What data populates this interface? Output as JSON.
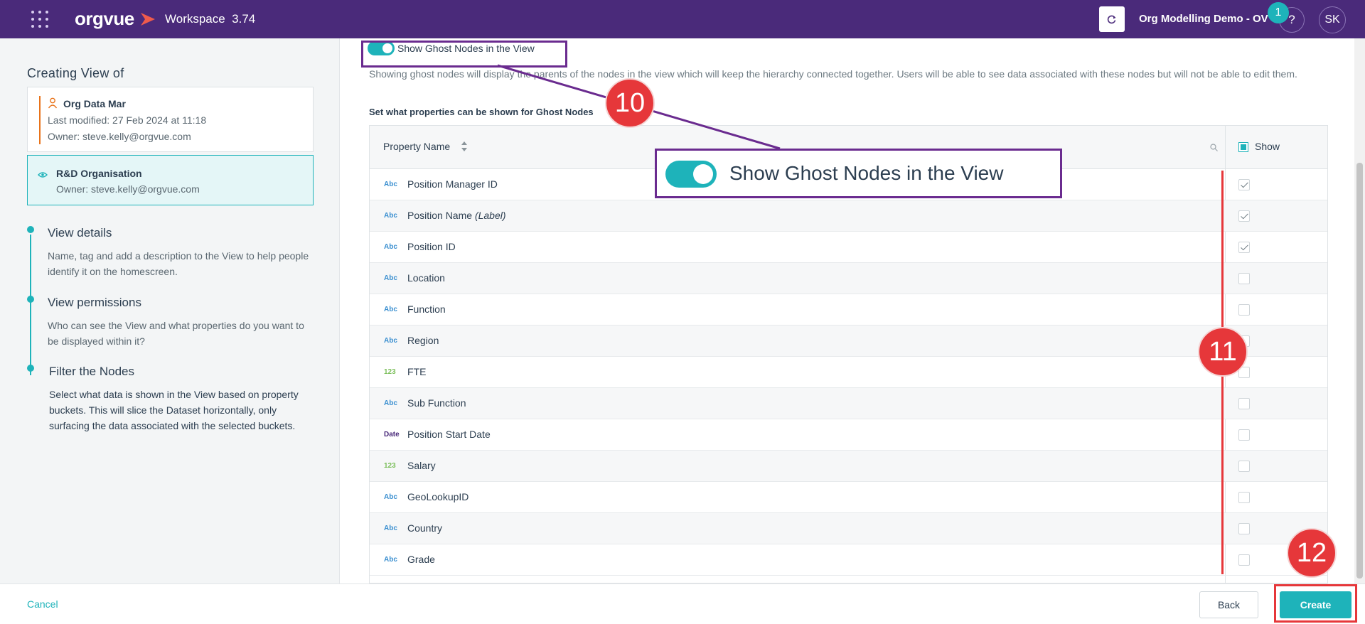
{
  "topbar": {
    "logo_text": "orgvue",
    "workspace_label": "Workspace",
    "version": "3.74",
    "dataset_name": "Org Modelling Demo - OV",
    "notification_count": "1",
    "help_label": "?",
    "user_initials": "SK"
  },
  "left": {
    "creating_title": "Creating View of",
    "dataset": {
      "title": "Org Data Mar",
      "last_modified": "Last modified: 27 Feb 2024 at 11:18",
      "owner": "Owner: steve.kelly@orgvue.com"
    },
    "view": {
      "title": "R&D Organisation",
      "owner": "Owner: steve.kelly@orgvue.com"
    },
    "steps": [
      {
        "title": "View details",
        "desc": "Name, tag and add a description to the View to help people identify it on the homescreen."
      },
      {
        "title": "View permissions",
        "desc": "Who can see the View and what properties do you want to be displayed within it?"
      },
      {
        "title": "Filter the Nodes",
        "desc": "Select what data is shown in the View based on property buckets. This will slice the Dataset horizontally, only surfacing the data associated with the selected buckets."
      }
    ]
  },
  "main": {
    "toggle_label": "Show Ghost Nodes in the View",
    "toggle_on": true,
    "ghost_desc": "Showing ghost nodes will display the parents of the nodes in the view which will keep the hierarchy connected together. Users will be able to see data associated with these nodes but will not be able to edit them.",
    "props_heading": "Set what properties can be shown for Ghost Nodes",
    "table": {
      "col_name": "Property Name",
      "col_show": "Show",
      "rows": [
        {
          "type": "Abc",
          "name": "Position Manager ID",
          "suffix": "",
          "checked": true
        },
        {
          "type": "Abc",
          "name": "Position Name",
          "suffix": "(Label)",
          "checked": true
        },
        {
          "type": "Abc",
          "name": "Position ID",
          "suffix": "",
          "checked": true
        },
        {
          "type": "Abc",
          "name": "Location",
          "suffix": "",
          "checked": false
        },
        {
          "type": "Abc",
          "name": "Function",
          "suffix": "",
          "checked": false
        },
        {
          "type": "Abc",
          "name": "Region",
          "suffix": "",
          "checked": false
        },
        {
          "type": "123",
          "name": "FTE",
          "suffix": "",
          "checked": false
        },
        {
          "type": "Abc",
          "name": "Sub Function",
          "suffix": "",
          "checked": false
        },
        {
          "type": "Date",
          "name": "Position Start Date",
          "suffix": "",
          "checked": false
        },
        {
          "type": "123",
          "name": "Salary",
          "suffix": "",
          "checked": false
        },
        {
          "type": "Abc",
          "name": "GeoLookupID",
          "suffix": "",
          "checked": false
        },
        {
          "type": "Abc",
          "name": "Country",
          "suffix": "",
          "checked": false
        },
        {
          "type": "Abc",
          "name": "Grade",
          "suffix": "",
          "checked": false
        }
      ]
    }
  },
  "footer": {
    "cancel_label": "Cancel",
    "back_label": "Back",
    "create_label": "Create"
  },
  "annotations": {
    "marker_10": "10",
    "marker_11": "11",
    "marker_12": "12",
    "callout_text": "Show Ghost Nodes in the View"
  },
  "colors": {
    "brand_purple": "#4a2a7a",
    "accent_teal": "#1eb3ba",
    "annotation_red": "#e6373a",
    "annotation_purple": "#6a2b8f",
    "owner_accent": "#e8731a"
  },
  "icons": [
    "apps-grid-icon",
    "orgvue-logo-mark",
    "refresh-icon",
    "person-icon",
    "eye-icon",
    "sort-icon",
    "search-icon",
    "checkbox-icon"
  ]
}
